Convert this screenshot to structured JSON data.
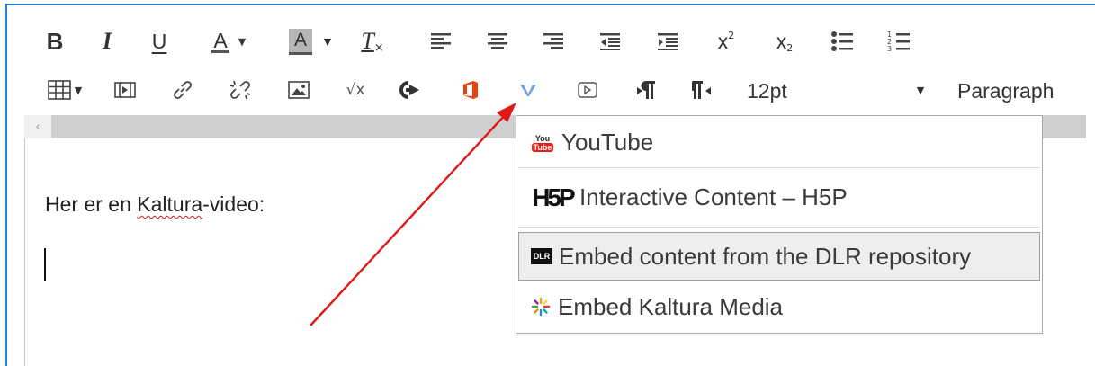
{
  "toolbar_row1": {
    "bold": "B",
    "italic": "I",
    "underline": "U",
    "font_color": "A",
    "bg_color": "A",
    "clear_format": "T",
    "superscript": "x",
    "superscript_mark": "2",
    "subscript": "x",
    "subscript_mark": "2"
  },
  "toolbar_row2": {
    "font_size": "12pt",
    "block_format": "Paragraph"
  },
  "editor": {
    "text_before": "Her er en ",
    "text_misspelled": "Kaltura",
    "text_after": "-video:"
  },
  "scroll": {
    "left_arrow": "‹"
  },
  "menu": {
    "items": [
      {
        "label": "YouTube",
        "icon": "youtube-icon"
      },
      {
        "label": "Interactive Content – H5P",
        "icon": "h5p-icon"
      },
      {
        "label": "Embed content from the DLR repository",
        "icon": "dlr-icon"
      },
      {
        "label": "Embed Kaltura Media",
        "icon": "kaltura-icon"
      }
    ],
    "youtube_icon_top": "You",
    "youtube_icon_bottom": "Tube",
    "h5p_icon_text": "H5P",
    "dlr_icon_text": "DLR"
  },
  "colors": {
    "frame_border": "#2a7fd4",
    "arrow": "#e01818",
    "office": "#e8410b",
    "vimeo": "#7aa2d6",
    "youtube": "#e62117"
  }
}
